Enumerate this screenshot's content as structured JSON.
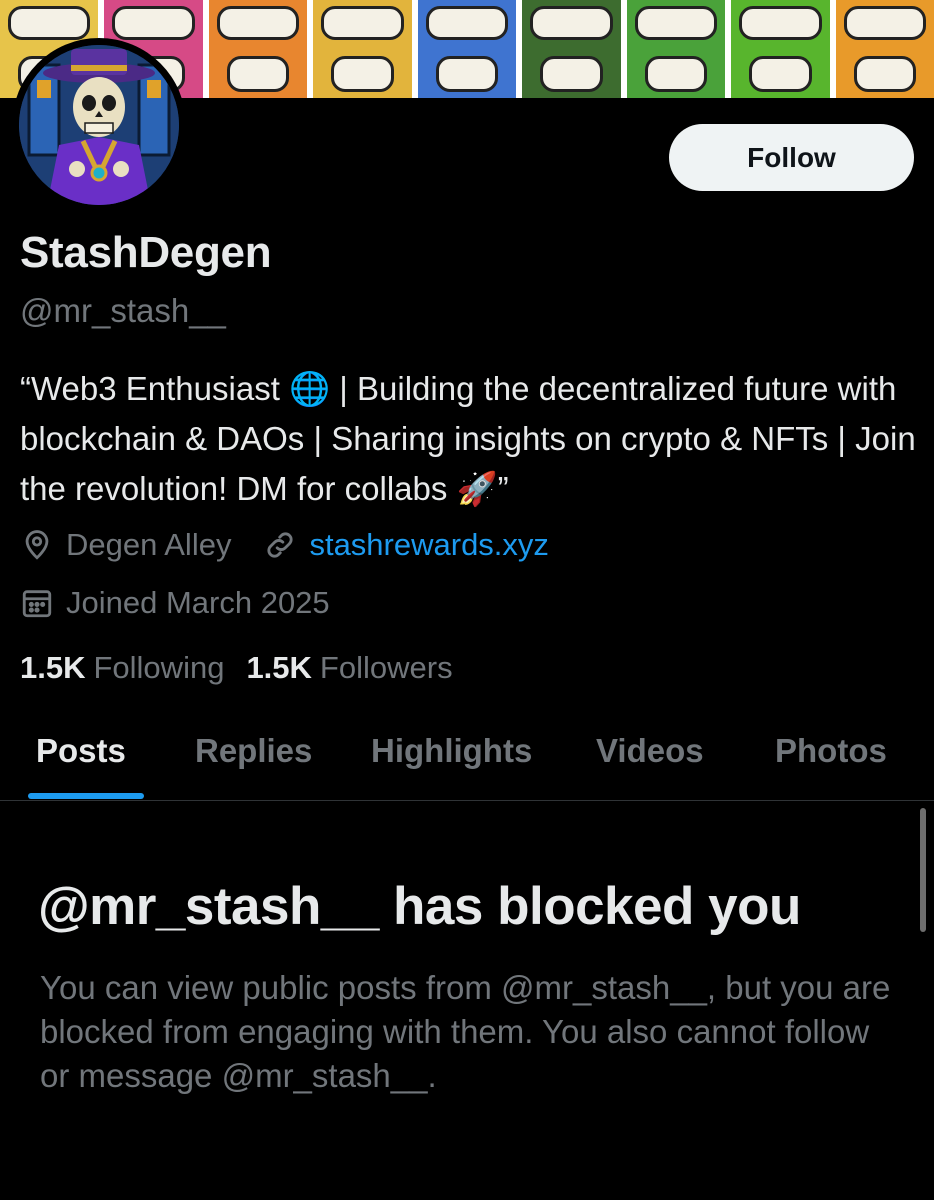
{
  "profile": {
    "display_name": "StashDegen",
    "handle": "@mr_stash__",
    "bio": "“Web3 Enthusiast 🌐 | Building the decentralized future with blockchain & DAOs | Sharing insights on crypto & NFTs | Join the revolution! DM for collabs 🚀”",
    "location": "Degen Alley",
    "website": "stashrewards.xyz",
    "joined": "Joined March 2025",
    "following_count": "1.5K",
    "following_label": "Following",
    "followers_count": "1.5K",
    "followers_label": "Followers"
  },
  "actions": {
    "follow_label": "Follow"
  },
  "tabs": [
    {
      "label": "Posts",
      "active": true
    },
    {
      "label": "Replies",
      "active": false
    },
    {
      "label": "Highlights",
      "active": false
    },
    {
      "label": "Videos",
      "active": false
    },
    {
      "label": "Photos",
      "active": false
    }
  ],
  "blocked": {
    "title": "@mr_stash__ has blocked you",
    "description": "You can view public posts from @mr_stash__, but you are blocked from engaging with them. You also cannot follow or message @mr_stash__."
  },
  "icons": {
    "location": "location-pin-icon",
    "link": "link-icon",
    "calendar": "calendar-icon"
  },
  "colors": {
    "background": "#000000",
    "text_primary": "#e7e9ea",
    "text_secondary": "#71767b",
    "accent": "#1d9bf0",
    "follow_button_bg": "#eff3f4"
  },
  "banner": {
    "panel_colors": [
      "#e7c44a",
      "#d64a86",
      "#e8862f",
      "#e2b43c",
      "#3f74d0",
      "#3d6c2f",
      "#4aa23a",
      "#58b52d",
      "#e89a2a"
    ]
  }
}
